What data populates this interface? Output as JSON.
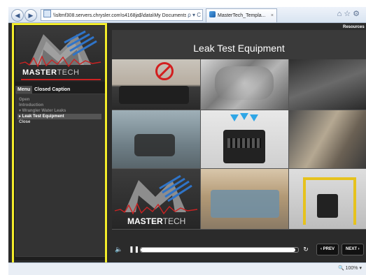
{
  "browser": {
    "address": "\\\\sltmf308.servers.chrysler.com\\s4168ja$\\data\\My Documents\\",
    "address_icons": "ρ ▾ C",
    "tab_title": "MasterTech_Templa...",
    "tab_close": "×",
    "toolbar_icons": "⌂☆⚙"
  },
  "player": {
    "logo_text_main": "MASTER",
    "logo_text_accent": "TECH",
    "tabs": {
      "menu": "Menu",
      "closed_caption": "Closed Caption"
    },
    "menu_items": [
      {
        "label": "Open"
      },
      {
        "label": "Introduction"
      },
      {
        "label": "▾ Wrangler Water Leaks"
      },
      {
        "label": "▸ Leak Test Equipment"
      },
      {
        "label": "Close"
      }
    ],
    "resources": "Resources",
    "slide_title": "Leak Test Equipment",
    "tile_logo_main": "MASTER",
    "tile_logo_accent": "TECH",
    "progress": 0.98,
    "controls": {
      "prev": "‹ PREV",
      "next": "NEXT ›"
    }
  },
  "status": {
    "zoom": "🔍 100%  ▾"
  },
  "colors": {
    "highlight": "#f3ec2a",
    "player_bg": "#2b2b2b",
    "accent_red": "#cc2222",
    "accent_blue": "#2fa6e6"
  }
}
